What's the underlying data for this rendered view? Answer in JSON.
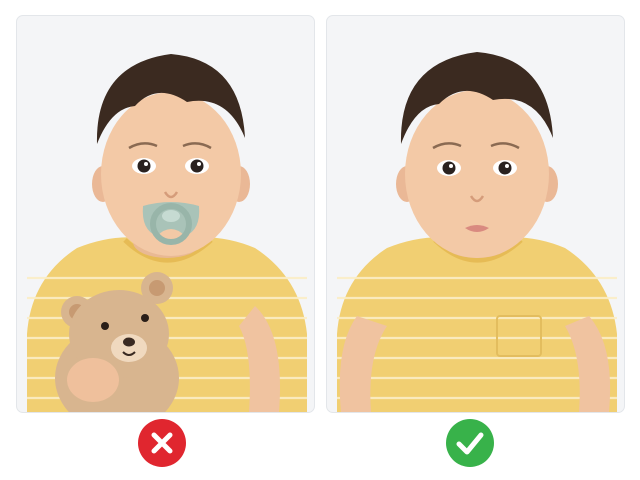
{
  "colors": {
    "background": "#ffffff",
    "panel_border": "#e3e6ea",
    "panel_background": "#f4f5f7",
    "wrong_badge": "#e0262f",
    "correct_badge": "#38b24a",
    "shirt": "#f1cf72",
    "shirt_stripe": "#fbeec6",
    "skin": "#f3c9a6",
    "hair": "#3b2a20",
    "pacifier": "#a9c3b8",
    "teddy_bear": "#d8b58f"
  },
  "panels": [
    {
      "id": "left",
      "verdict": "incorrect",
      "icon": "x-icon",
      "items_in_photo": [
        "pacifier",
        "teddy-bear"
      ]
    },
    {
      "id": "right",
      "verdict": "correct",
      "icon": "check-icon",
      "items_in_photo": []
    }
  ]
}
